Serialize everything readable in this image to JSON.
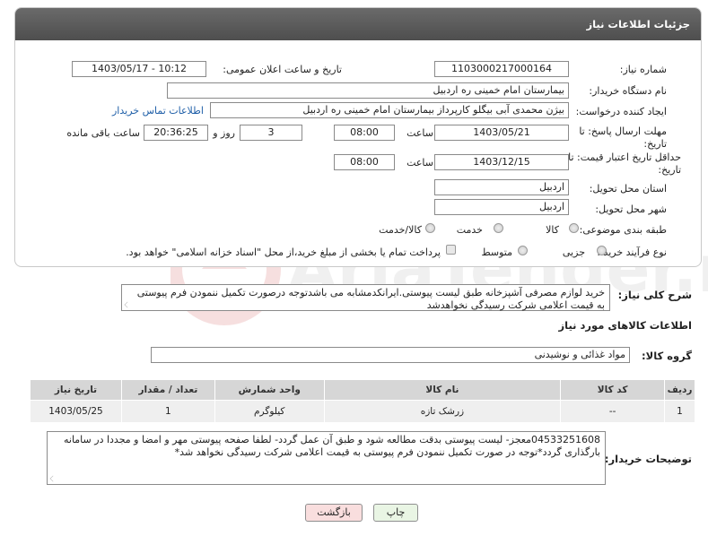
{
  "panel": {
    "title": "جزئیات اطلاعات نیاز"
  },
  "fields": {
    "need_number_label": "شماره نیاز:",
    "need_number": "1103000217000164",
    "announce_label": "تاریخ و ساعت اعلان عمومی:",
    "announce_value": "1403/05/17 - 10:12",
    "buyer_org_label": "نام دستگاه خریدار:",
    "buyer_org": "بیمارستان امام خمینی  ره  اردبیل",
    "creator_label": "ایجاد کننده درخواست:",
    "creator": "بیژن محمدی آبی بیگلو کارپرداز بیمارستان امام خمینی  ره  اردبیل",
    "contact_link": "اطلاعات تماس خریدار",
    "deadline_label": "مهلت ارسال پاسخ: تا تاریخ:",
    "deadline_date": "1403/05/21",
    "time_label": "ساعت",
    "deadline_time": "08:00",
    "days_value": "3",
    "days_label": "روز و",
    "remaining_time": "20:36:25",
    "remaining_label": "ساعت باقی مانده",
    "validity_label": "حداقل تاریخ اعتبار قیمت: تا تاریخ:",
    "validity_date": "1403/12/15",
    "validity_time": "08:00",
    "province_label": "استان محل تحویل:",
    "province": "اردبیل",
    "city_label": "شهر محل تحویل:",
    "city": "اردبیل",
    "category_label": "طبقه بندی موضوعی:",
    "category_options": [
      "کالا",
      "خدمت",
      "کالا/خدمت"
    ],
    "process_label": "نوع فرآیند خرید :",
    "process_options": [
      "جزیی",
      "متوسط"
    ],
    "payment_note": "پرداخت تمام یا بخشی از مبلغ خرید،از محل \"اسناد خزانه اسلامی\" خواهد بود."
  },
  "description": {
    "label": "شرح کلی نیاز:",
    "text": "خرید لوازم مصرفی آشپزخانه طبق لیست پیوستی.ایرانکدمشابه می باشدتوجه درصورت تکمیل ننمودن فرم پیوستی به قیمت اعلامی شرکت رسیدگی نخواهدشد"
  },
  "goods": {
    "section_title": "اطلاعات کالاهای مورد نیاز",
    "group_label": "گروه کالا:",
    "group_value": "مواد غذائی و نوشیدنی"
  },
  "table": {
    "headers": [
      "ردیف",
      "کد کالا",
      "نام کالا",
      "واحد شمارش",
      "تعداد / مقدار",
      "تاریخ نیاز"
    ],
    "rows": [
      [
        "1",
        "--",
        "زرشک تازه",
        "کیلوگرم",
        "1",
        "1403/05/25"
      ]
    ]
  },
  "buyer_notes": {
    "label": "توضیحات خریدار:",
    "text": "04533251608معجز- لیست پیوستی بدقت مطالعه شود و طبق آن عمل گردد- لطفا صفحه پیوستی مهر و امضا و مجددا در سامانه بارگذاری گردد*توجه در صورت تکمیل ننمودن فرم پیوستی به قیمت اعلامی شرکت رسیدگی نخواهد شد*"
  },
  "buttons": {
    "print": "چاپ",
    "back": "بازگشت"
  },
  "colors": {
    "header_bg": "#5a5a5a",
    "link": "#1f5fa8",
    "back_btn_bg": "#f9dede",
    "print_btn_bg": "#e9f5e4"
  }
}
